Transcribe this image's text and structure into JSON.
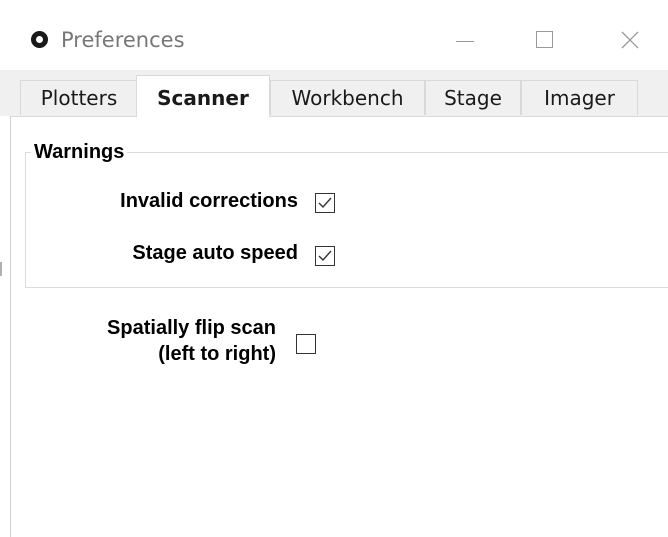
{
  "window": {
    "title": "Preferences",
    "icon": "app-ring-icon",
    "controls": [
      "minimize-icon",
      "maximize-icon",
      "close-icon"
    ]
  },
  "tabs": [
    {
      "label": "Plotters",
      "active": false
    },
    {
      "label": "Scanner",
      "active": true
    },
    {
      "label": "Workbench",
      "active": false
    },
    {
      "label": "Stage",
      "active": false
    },
    {
      "label": "Imager",
      "active": false
    }
  ],
  "warnings": {
    "legend": "Warnings",
    "items": [
      {
        "label": "Invalid corrections",
        "checked": true
      },
      {
        "label": "Stage auto speed",
        "checked": true
      }
    ]
  },
  "flip_scan": {
    "label_line1": "Spatially flip scan",
    "label_line2": "(left to right)",
    "checked": false
  },
  "colors": {
    "tab_background": "#f0f0f0",
    "active_tab": "#ffffff",
    "border": "#d9d9d9"
  }
}
